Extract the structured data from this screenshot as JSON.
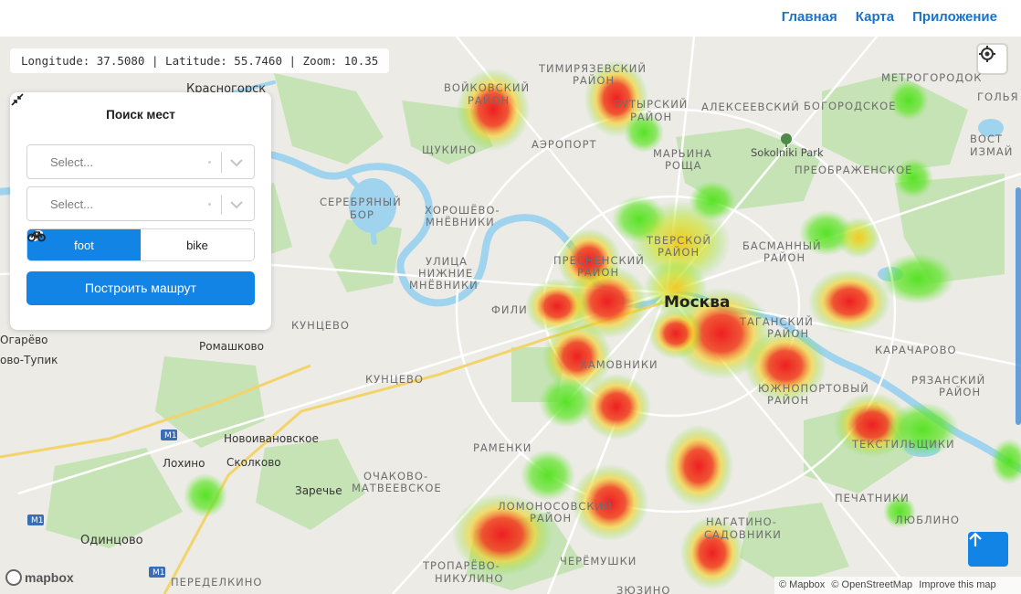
{
  "nav": {
    "home": "Главная",
    "map": "Карта",
    "app": "Приложение"
  },
  "map": {
    "coords_readout": "Longitude: 37.5080 | Latitude: 55.7460 | Zoom: 10.35",
    "city_label": "Москва",
    "labels": [
      "Красногорск",
      "ВОЙКОВСКИЙ",
      "РАЙОН",
      "ТИМИРЯЗЕВСКИЙ",
      "РАЙОН",
      "БУТЫРСКИЙ",
      "РАЙОН",
      "АЛЕКСЕЕВСКИЙ",
      "БОГОРОДСКОЕ",
      "МЕТРОГОРОДОК",
      "ГОЛЬЯ",
      "ЩУКИНО",
      "АЭРОПОРТ",
      "МАРЬИНА",
      "РОЩА",
      "Sokolniki Park",
      "ПРЕОБРАЖЕНСКОЕ",
      "ВОСТ",
      "ИЗМАЙ",
      "СЕРЕБРЯНЫЙ",
      "БОР",
      "ХОРОШЁВО-",
      "МНЁВНИКИ",
      "ТВЕРСКОЙ",
      "РАЙОН",
      "БАСМАННЫЙ",
      "РАЙОН",
      "ПРЕСНЕНСКИЙ",
      "РАЙОН",
      "УЛИЦА",
      "НИЖНИЕ",
      "МНЁВНИКИ",
      "ФИЛИ",
      "КУНЦЕВО",
      "ТАГАНСКИЙ",
      "РАЙОН",
      "Огарёво",
      "ово-Тупик",
      "Ромашково",
      "ХАМОВНИКИ",
      "КАРАЧАРОВО",
      "КУНЦЕВО",
      "ЮЖНОПОРТОВЫЙ",
      "РАЙОН",
      "РЯЗАНСКИЙ",
      "РАЙОН",
      "Новоивановское",
      "Лохино",
      "Сколково",
      "РАМЕНКИ",
      "ТЕКСТИЛЬЩИКИ",
      "Заречье",
      "ОЧАКОВО-",
      "МАТВЕЕВСКОЕ",
      "ЛОМОНОСОВСКИЙ",
      "РАЙОН",
      "ПЕЧАТНИКИ",
      "Одинцово",
      "НАГАТИНО-",
      "САДОВНИКИ",
      "ЛЮБЛИНО",
      "ТРОПАРЁВО-",
      "НИКУЛИНО",
      "ЧЕРЁМУШКИ",
      "ПЕРЕДЕЛКИНО",
      "ЗЮЗИНО",
      "M1",
      "M1",
      "M1"
    ]
  },
  "search_panel": {
    "title": "Поиск мест",
    "from_placeholder": "Select...",
    "to_placeholder": "Select...",
    "mode_foot": "foot",
    "mode_bike": "bike",
    "build_route": "Построить машрут"
  },
  "footer": {
    "logo": "mapbox",
    "attrib_mapbox": "© Mapbox",
    "attrib_osm": "© OpenStreetMap",
    "attrib_improve": "Improve this map"
  },
  "colors": {
    "accent": "#1284e6",
    "nav_link": "#1a73c7",
    "map_bg": "#ecebe6",
    "water": "#9fd3ee",
    "park": "#c6e3b6",
    "heat_low": "#4fe21a",
    "heat_mid": "#f2d21b",
    "heat_high": "#ee2a24"
  }
}
